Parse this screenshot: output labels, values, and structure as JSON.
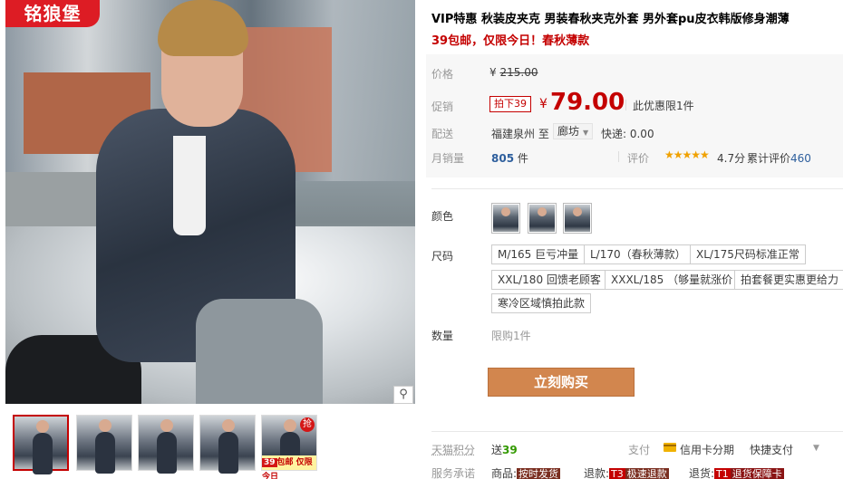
{
  "gallery": {
    "brand_badge": "铭狼堡",
    "zoom_icon": "magnifier-icon",
    "thumbnails": [
      {
        "promo": "",
        "tag": ""
      },
      {
        "promo": "",
        "tag": ""
      },
      {
        "promo": "",
        "tag": ""
      },
      {
        "promo": "",
        "tag": ""
      },
      {
        "promo_num": "39",
        "promo": "包邮 仅限今日",
        "tag": "抢"
      }
    ]
  },
  "product": {
    "title": "VIP特惠 秋装皮夹克 男装春秋夹克外套 男外套pu皮衣韩版修身潮薄",
    "subtitle": "39包邮，仅限今日！春秋薄款"
  },
  "pricing": {
    "label_price": "价格",
    "original_currency": "¥",
    "original_price": "215.00",
    "label_promo": "促销",
    "promo_tag": "拍下39",
    "current_currency": "¥",
    "current_price": "79.00",
    "limit_note": "此优惠限1件",
    "label_ship": "配送",
    "ship_from": "福建泉州",
    "ship_to_word": "至",
    "ship_dest": "廊坊",
    "ship_fee": "快递: 0.00",
    "label_sales": "月销量",
    "sales_count": "805",
    "sales_unit": "件",
    "label_review": "评价",
    "stars": "★★★★★",
    "score": "4.7分",
    "review_prefix": "累计评价",
    "review_count": "460"
  },
  "options": {
    "label_color": "颜色",
    "colors": 3,
    "label_size": "尺码",
    "sizes": [
      "M/165 巨亏冲量",
      "L/170（春秋薄款）",
      "XL/175尺码标准正常",
      "XXL/180 回馈老顾客",
      "XXXL/185 （够量就涨价",
      "拍套餐更实惠更给力",
      "寒冷区域慎拍此款"
    ],
    "label_qty": "数量",
    "qty_note": "限购1件"
  },
  "actions": {
    "buy_now": "立刻购买"
  },
  "footer": {
    "label_points": "天猫积分",
    "points_prefix": "送",
    "points_value": "39",
    "label_pay": "支付",
    "installment": "信用卡分期",
    "quickpay": "快捷支付",
    "label_service": "服务承诺",
    "svc1_prefix": "商品:",
    "svc1_badge": "按时发货",
    "svc2_prefix": "退款:",
    "svc2_code": "T3",
    "svc2_badge": "极速退款",
    "svc3_prefix": "退货:",
    "svc3_code": "T1",
    "svc3_badge": "退货保障卡"
  },
  "colors": {
    "accent_red": "#c40000",
    "buy_button": "#d2864e",
    "star": "#f0a100",
    "link_blue": "#2e5f9d"
  }
}
